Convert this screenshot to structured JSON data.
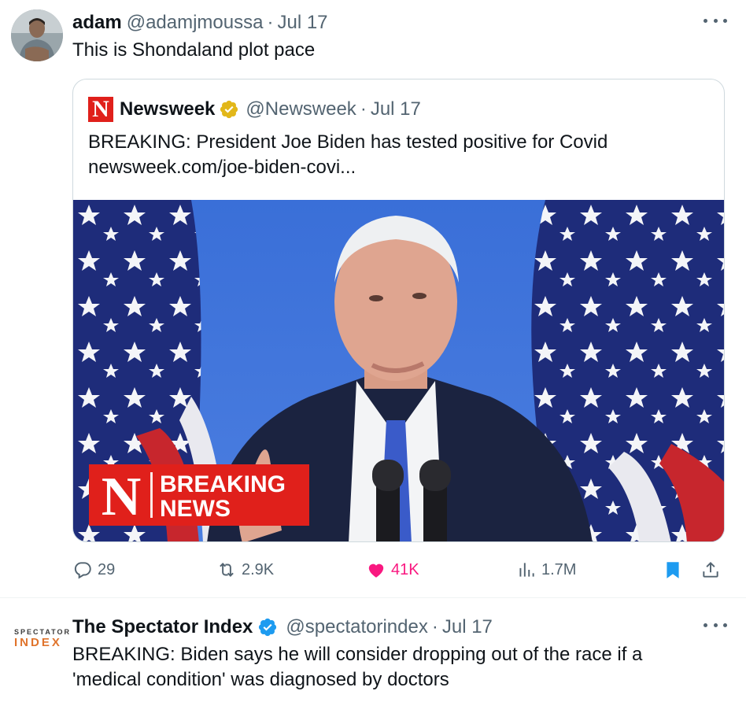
{
  "tweet1": {
    "author_name": "adam",
    "author_handle": "@adamjmoussa",
    "separator": "·",
    "date": "Jul 17",
    "text": "This is Shondaland plot pace",
    "quote": {
      "logo_letter": "N",
      "author_name": "Newsweek",
      "author_handle": "@Newsweek",
      "separator": "·",
      "date": "Jul 17",
      "text_line1": "BREAKING: President Joe Biden has tested positive for Covid",
      "text_line2": "newsweek.com/joe-biden-covi...",
      "image": {
        "banner_letter": "N",
        "banner_line1": "BREAKING",
        "banner_line2": "NEWS"
      }
    },
    "actions": {
      "replies": "29",
      "reposts": "2.9K",
      "likes": "41K",
      "views": "1.7M"
    }
  },
  "tweet2": {
    "logo_top": "SPECTATOR",
    "logo_bottom": "INDEX",
    "author_name": "The Spectator Index",
    "author_handle": "@spectatorindex",
    "separator": "·",
    "date": "Jul 17",
    "text_line1": "BREAKING: Biden says he will consider dropping out of the race if a",
    "text_line2": "'medical condition' was diagnosed by doctors"
  },
  "colors": {
    "like_pink": "#f91880",
    "verified_blue": "#1d9bf0",
    "verified_gold": "#e2b719",
    "bookmark_blue": "#1d9bf0",
    "newsweek_red": "#e0201b",
    "muted_gray": "#536471"
  },
  "icons": [
    "more-icon",
    "verified-gold-icon",
    "verified-blue-icon",
    "reply-icon",
    "repost-icon",
    "like-icon",
    "views-icon",
    "bookmark-icon",
    "share-icon"
  ]
}
